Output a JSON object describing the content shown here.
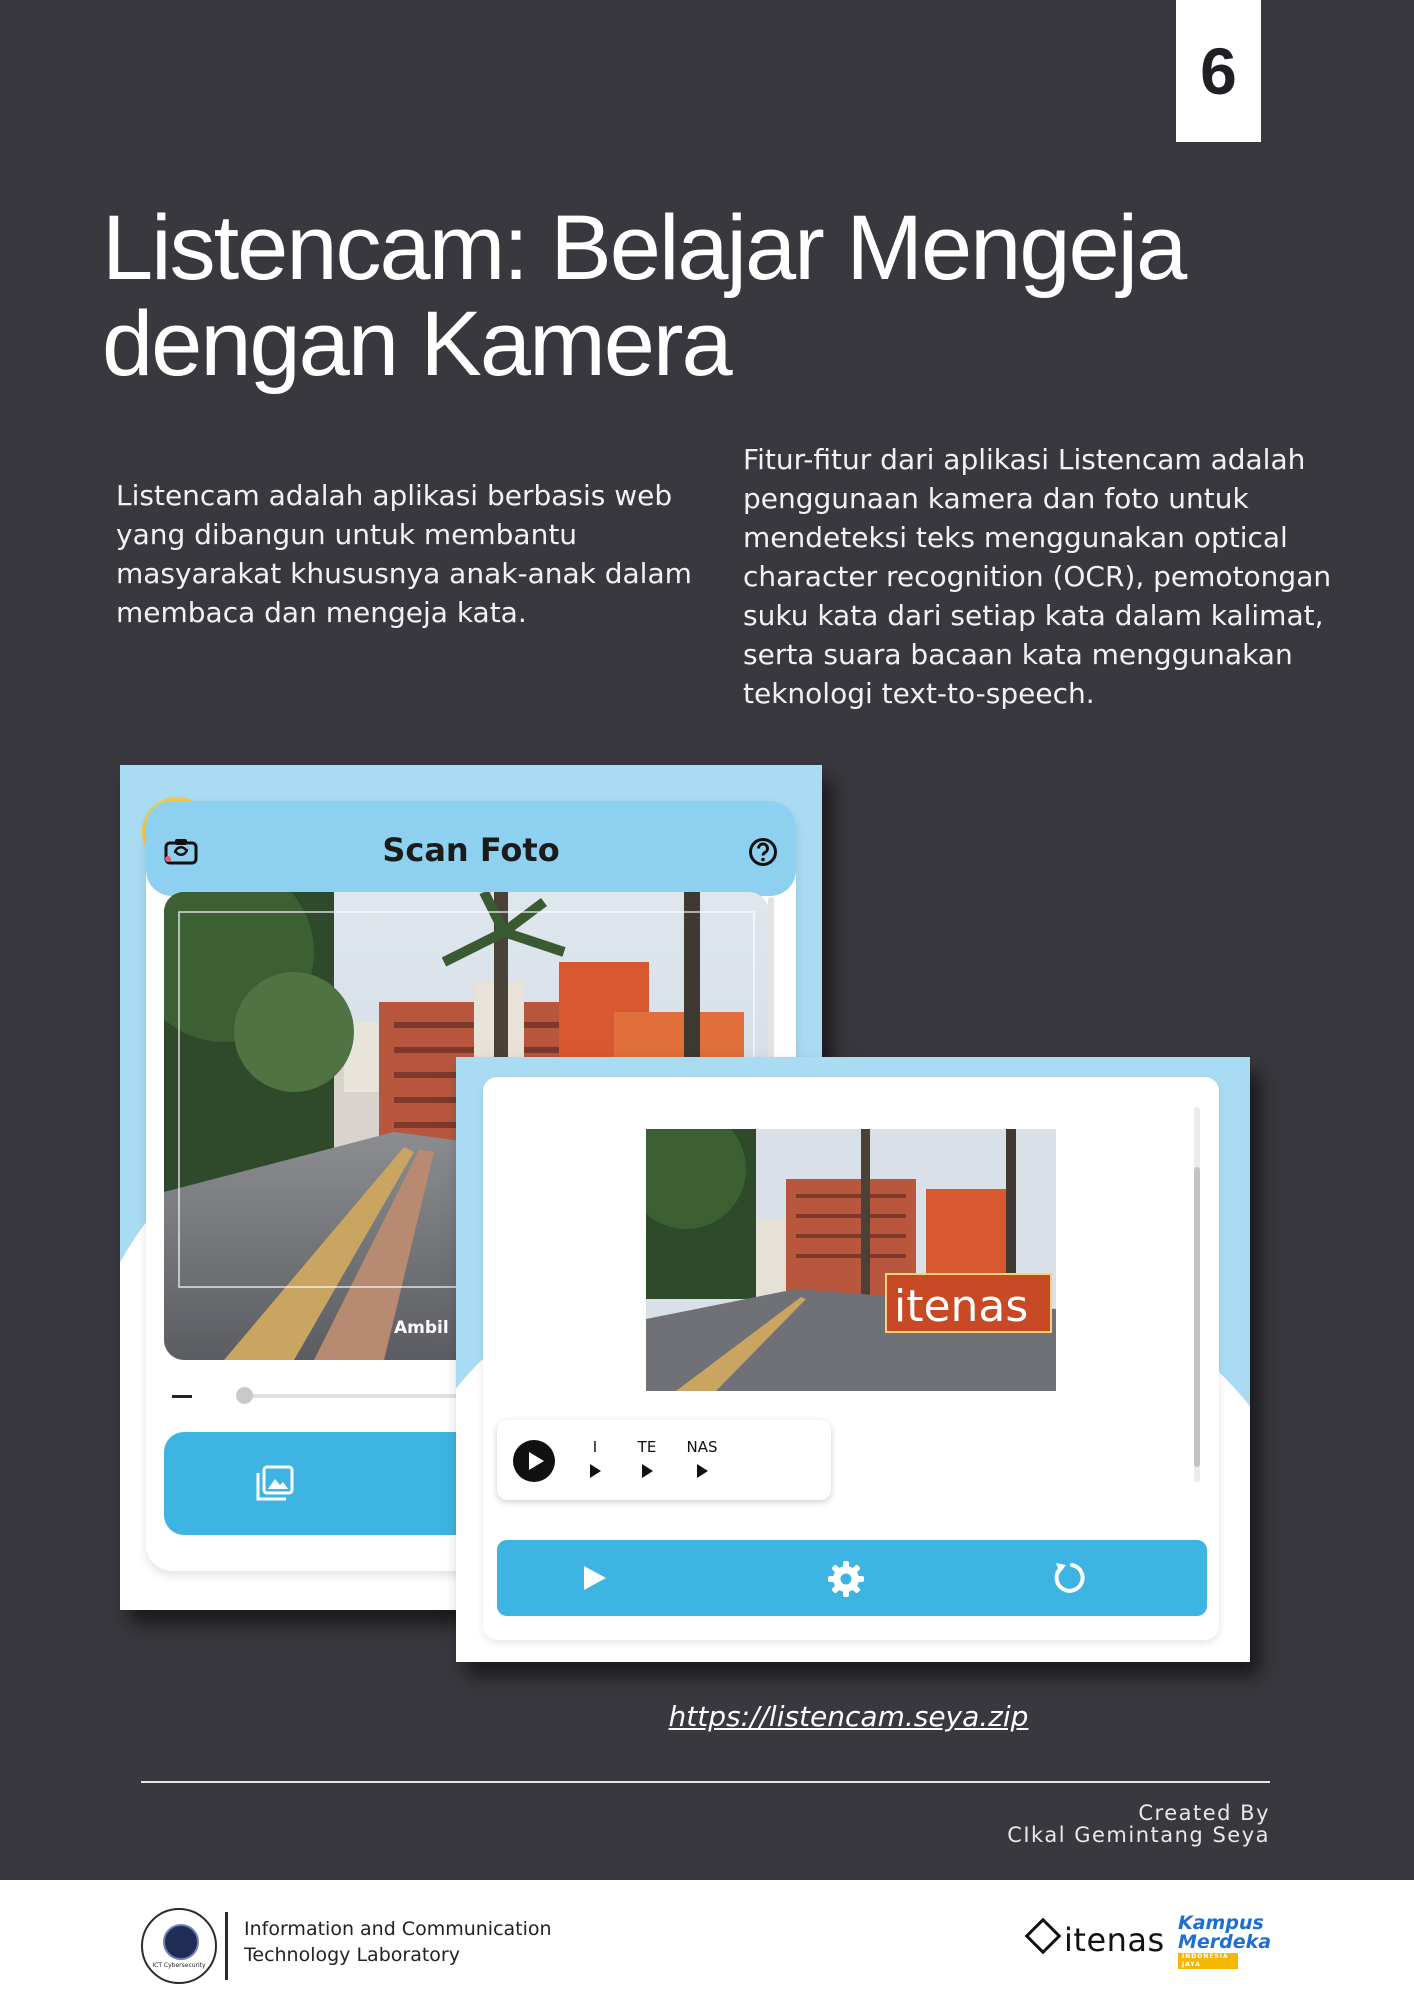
{
  "page_number": "6",
  "title": {
    "line1": "Listencam: Belajar Mengeja",
    "line2": "dengan Kamera"
  },
  "intro_text": "Listencam adalah aplikasi berbasis web yang dibangun untuk membantu masyarakat khususnya anak-anak dalam membaca dan mengeja kata.",
  "features_text": "Fitur-fitur dari aplikasi Listencam adalah penggunaan kamera dan foto untuk mendeteksi teks menggunakan optical character recognition (OCR), pemotongan suku kata dari setiap kata dalam kalimat, serta suara bacaan kata menggunakan teknologi text-to-speech.",
  "scan_screen": {
    "title": "Scan Foto",
    "capture_label": "Ambil",
    "icons": [
      "camera-switch-icon",
      "help-icon",
      "gallery-icon"
    ],
    "colors": {
      "accent": "#3eb4e2",
      "header": "#8dd0ef",
      "background": "#a9dcf3"
    }
  },
  "result_screen": {
    "detected_word": "itenas",
    "syllables": [
      "I",
      "TE",
      "NAS"
    ],
    "icons": [
      "play-all-icon",
      "play-icon",
      "gear-icon",
      "reset-icon"
    ]
  },
  "link": "https://listencam.seya.zip",
  "credits": {
    "label": "Created By",
    "name": "CIkal Gemintang Seya"
  },
  "footer": {
    "lab_line1": "Information and Communication",
    "lab_line2": "Technology Laboratory",
    "lab_logo_text": "ICT Cybersecurity",
    "itenas_logo": "itenas",
    "kampus_line1": "Kampus",
    "kampus_line2": "Merdeka",
    "kampus_tag": "INDONESIA JAYA"
  }
}
